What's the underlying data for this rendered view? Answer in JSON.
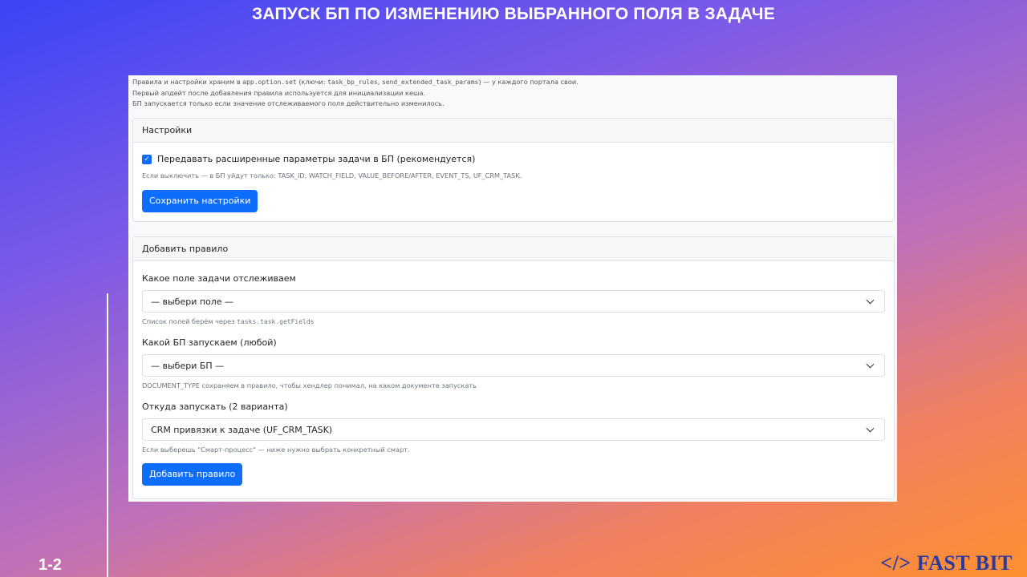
{
  "slide": {
    "title": "ЗАПУСК БП ПО ИЗМЕНЕНИЮ ВЫБРАННОГО ПОЛЯ В ЗАДАЧЕ",
    "number": "1-2",
    "logo": "</> FAST BIT"
  },
  "intro": {
    "l1a": "Правила и настройки храним в ",
    "l1b": "app.option.set",
    "l1c": " (ключи: ",
    "l1d": "task_bp_rules",
    "l1e": ", ",
    "l1f": "send_extended_task_params",
    "l1g": ") — у каждого портала свои.",
    "l2": "Первый апдейт после добавления правила используется для инициализации кеша.",
    "l3": "БП запускается только если значение отслеживаемого поля действительно изменилось."
  },
  "settings": {
    "header": "Настройки",
    "checkbox_label": "Передавать расширенные параметры задачи в БП (рекомендуется)",
    "checked": true,
    "help": "Если выключить — в БП уйдут только: TASK_ID, WATCH_FIELD, VALUE_BEFORE/AFTER, EVENT_TS, UF_CRM_TASK.",
    "save_label": "Сохранить настройки"
  },
  "rule": {
    "header": "Добавить правило",
    "field_label": "Какое поле задачи отслеживаем",
    "field_value": "— выбери поле —",
    "field_help_a": "Список полей берём через ",
    "field_help_b": "tasks.task.getFields",
    "bp_label": "Какой БП запускаем (любой)",
    "bp_value": "— выбери БП —",
    "bp_help": "DOCUMENT_TYPE сохраняем в правило, чтобы хендлер понимал, на каком документе запускать",
    "source_label": "Откуда запускать (2 варианта)",
    "source_value": "CRM привязки к задаче (UF_CRM_TASK)",
    "source_help": "Если выберешь \"Смарт-процесс\" — ниже нужно выбрать конкретный смарт.",
    "add_label": "Добавить правило"
  }
}
